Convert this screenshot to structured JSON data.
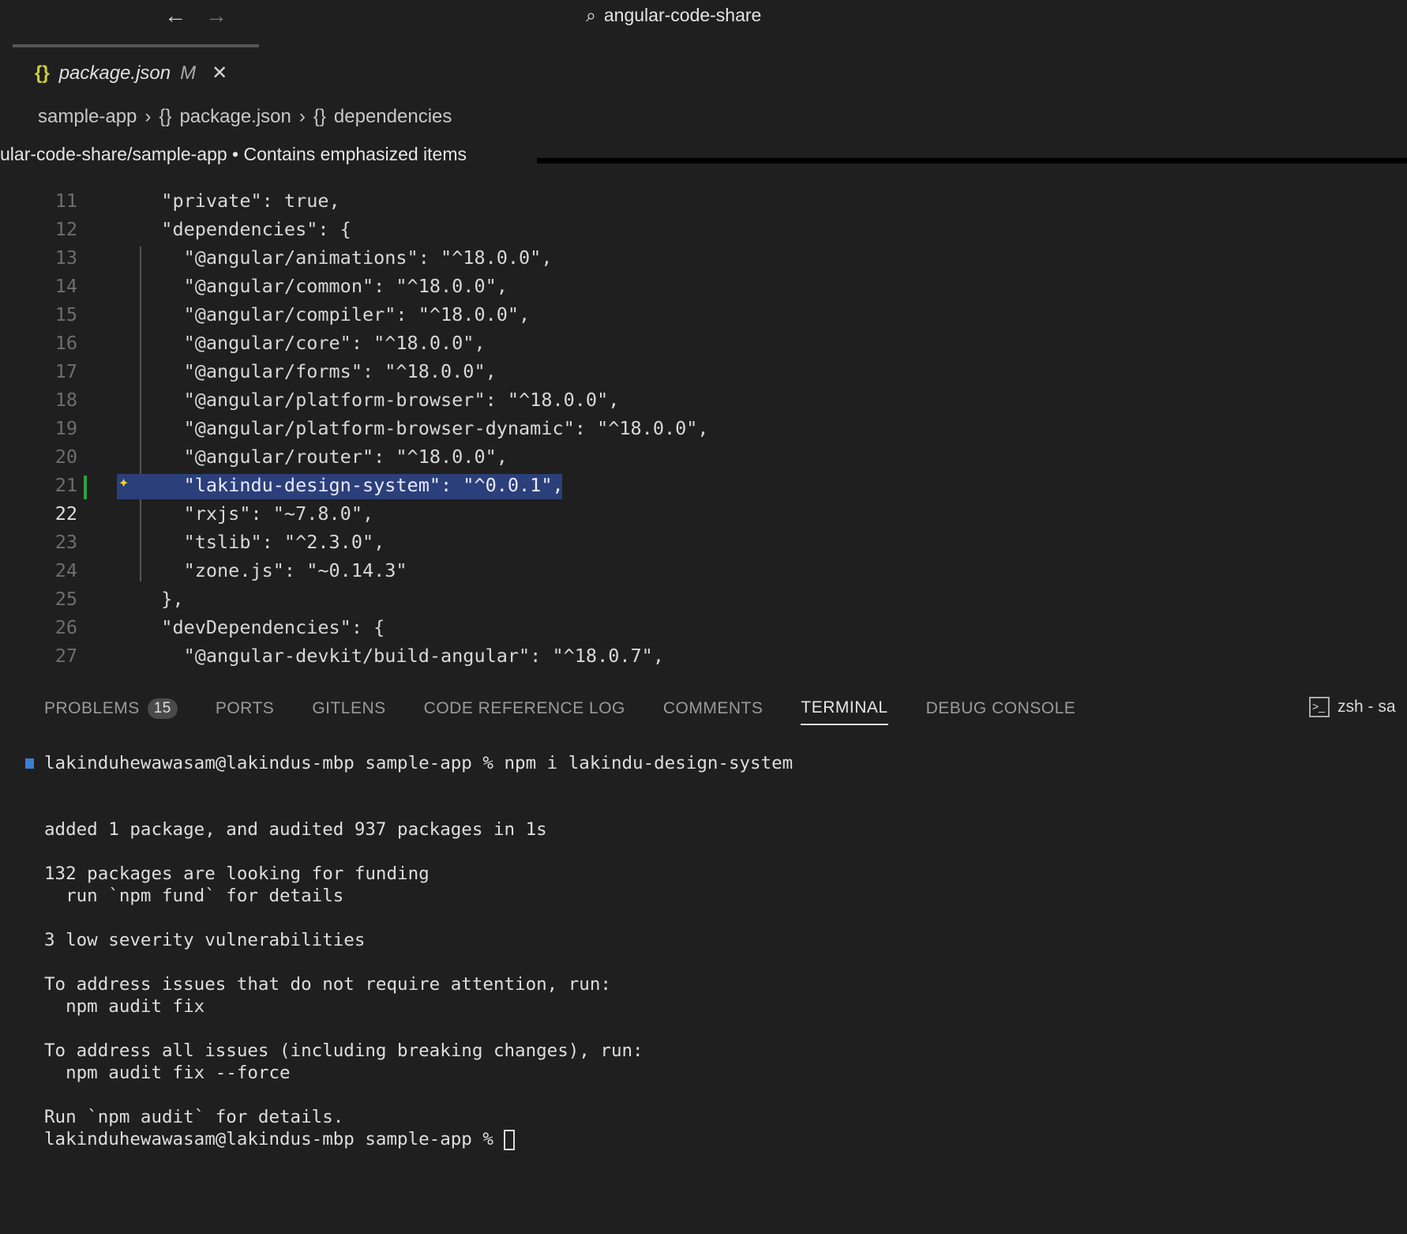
{
  "titlebar": {
    "title": "angular-code-share"
  },
  "tab": {
    "filename": "package.json",
    "status": "M"
  },
  "breadcrumb": [
    "sample-app",
    "package.json",
    "dependencies"
  ],
  "tooltip": "ular-code-share/sample-app • Contains emphasized items",
  "editor": {
    "lines": [
      {
        "num": "11",
        "text": "  \"private\": true,"
      },
      {
        "num": "12",
        "text": "  \"dependencies\": {"
      },
      {
        "num": "13",
        "text": "    \"@angular/animations\": \"^18.0.0\","
      },
      {
        "num": "14",
        "text": "    \"@angular/common\": \"^18.0.0\","
      },
      {
        "num": "15",
        "text": "    \"@angular/compiler\": \"^18.0.0\","
      },
      {
        "num": "16",
        "text": "    \"@angular/core\": \"^18.0.0\","
      },
      {
        "num": "17",
        "text": "    \"@angular/forms\": \"^18.0.0\","
      },
      {
        "num": "18",
        "text": "    \"@angular/platform-browser\": \"^18.0.0\","
      },
      {
        "num": "19",
        "text": "    \"@angular/platform-browser-dynamic\": \"^18.0.0\","
      },
      {
        "num": "20",
        "text": "    \"@angular/router\": \"^18.0.0\","
      },
      {
        "num": "21",
        "text": "    \"lakindu-design-system\": \"^0.0.1\","
      },
      {
        "num": "22",
        "text": "    \"rxjs\": \"~7.8.0\","
      },
      {
        "num": "23",
        "text": "    \"tslib\": \"^2.3.0\","
      },
      {
        "num": "24",
        "text": "    \"zone.js\": \"~0.14.3\""
      },
      {
        "num": "25",
        "text": "  },"
      },
      {
        "num": "26",
        "text": "  \"devDependencies\": {"
      },
      {
        "num": "27",
        "text": "    \"@angular-devkit/build-angular\": \"^18.0.7\","
      }
    ]
  },
  "panel": {
    "tabs": [
      "PROBLEMS",
      "PORTS",
      "GITLENS",
      "CODE REFERENCE LOG",
      "COMMENTS",
      "TERMINAL",
      "DEBUG CONSOLE"
    ],
    "problems_count": "15",
    "active": "TERMINAL",
    "shell": "zsh - sa"
  },
  "terminal": {
    "lines": [
      "lakinduhewawasam@lakindus-mbp sample-app % npm i lakindu-design-system",
      "",
      "",
      "added 1 package, and audited 937 packages in 1s",
      "",
      "132 packages are looking for funding",
      "  run `npm fund` for details",
      "",
      "3 low severity vulnerabilities",
      "",
      "To address issues that do not require attention, run:",
      "  npm audit fix",
      "",
      "To address all issues (including breaking changes), run:",
      "  npm audit fix --force",
      "",
      "Run `npm audit` for details."
    ],
    "prompt": "lakinduhewawasam@lakindus-mbp sample-app % "
  }
}
